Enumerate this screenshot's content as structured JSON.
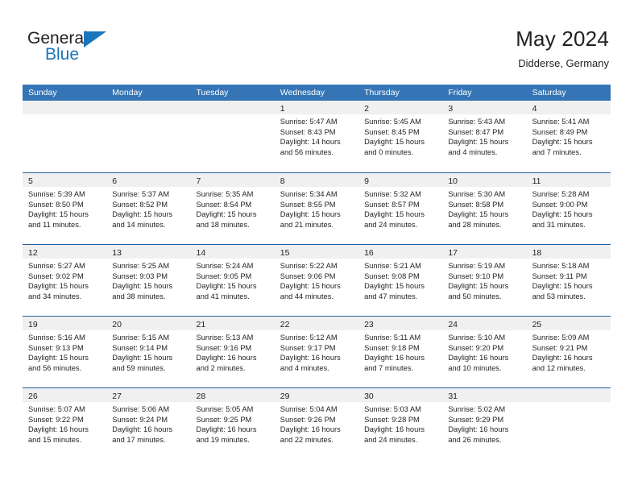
{
  "brand": {
    "name_part1": "General",
    "name_part2": "Blue"
  },
  "header": {
    "title": "May 2024",
    "subtitle": "Didderse, Germany"
  },
  "colors": {
    "header_blue": "#3575b5",
    "row_border_blue": "#1f5fa0",
    "day_band_gray": "#f0f0f0",
    "brand_blue": "#1b75bb",
    "text": "#231f20"
  },
  "weekdays": [
    "Sunday",
    "Monday",
    "Tuesday",
    "Wednesday",
    "Thursday",
    "Friday",
    "Saturday"
  ],
  "weeks": [
    [
      {
        "day": "",
        "lines": []
      },
      {
        "day": "",
        "lines": []
      },
      {
        "day": "",
        "lines": []
      },
      {
        "day": "1",
        "lines": [
          "Sunrise: 5:47 AM",
          "Sunset: 8:43 PM",
          "Daylight: 14 hours",
          "and 56 minutes."
        ]
      },
      {
        "day": "2",
        "lines": [
          "Sunrise: 5:45 AM",
          "Sunset: 8:45 PM",
          "Daylight: 15 hours",
          "and 0 minutes."
        ]
      },
      {
        "day": "3",
        "lines": [
          "Sunrise: 5:43 AM",
          "Sunset: 8:47 PM",
          "Daylight: 15 hours",
          "and 4 minutes."
        ]
      },
      {
        "day": "4",
        "lines": [
          "Sunrise: 5:41 AM",
          "Sunset: 8:49 PM",
          "Daylight: 15 hours",
          "and 7 minutes."
        ]
      }
    ],
    [
      {
        "day": "5",
        "lines": [
          "Sunrise: 5:39 AM",
          "Sunset: 8:50 PM",
          "Daylight: 15 hours",
          "and 11 minutes."
        ]
      },
      {
        "day": "6",
        "lines": [
          "Sunrise: 5:37 AM",
          "Sunset: 8:52 PM",
          "Daylight: 15 hours",
          "and 14 minutes."
        ]
      },
      {
        "day": "7",
        "lines": [
          "Sunrise: 5:35 AM",
          "Sunset: 8:54 PM",
          "Daylight: 15 hours",
          "and 18 minutes."
        ]
      },
      {
        "day": "8",
        "lines": [
          "Sunrise: 5:34 AM",
          "Sunset: 8:55 PM",
          "Daylight: 15 hours",
          "and 21 minutes."
        ]
      },
      {
        "day": "9",
        "lines": [
          "Sunrise: 5:32 AM",
          "Sunset: 8:57 PM",
          "Daylight: 15 hours",
          "and 24 minutes."
        ]
      },
      {
        "day": "10",
        "lines": [
          "Sunrise: 5:30 AM",
          "Sunset: 8:58 PM",
          "Daylight: 15 hours",
          "and 28 minutes."
        ]
      },
      {
        "day": "11",
        "lines": [
          "Sunrise: 5:28 AM",
          "Sunset: 9:00 PM",
          "Daylight: 15 hours",
          "and 31 minutes."
        ]
      }
    ],
    [
      {
        "day": "12",
        "lines": [
          "Sunrise: 5:27 AM",
          "Sunset: 9:02 PM",
          "Daylight: 15 hours",
          "and 34 minutes."
        ]
      },
      {
        "day": "13",
        "lines": [
          "Sunrise: 5:25 AM",
          "Sunset: 9:03 PM",
          "Daylight: 15 hours",
          "and 38 minutes."
        ]
      },
      {
        "day": "14",
        "lines": [
          "Sunrise: 5:24 AM",
          "Sunset: 9:05 PM",
          "Daylight: 15 hours",
          "and 41 minutes."
        ]
      },
      {
        "day": "15",
        "lines": [
          "Sunrise: 5:22 AM",
          "Sunset: 9:06 PM",
          "Daylight: 15 hours",
          "and 44 minutes."
        ]
      },
      {
        "day": "16",
        "lines": [
          "Sunrise: 5:21 AM",
          "Sunset: 9:08 PM",
          "Daylight: 15 hours",
          "and 47 minutes."
        ]
      },
      {
        "day": "17",
        "lines": [
          "Sunrise: 5:19 AM",
          "Sunset: 9:10 PM",
          "Daylight: 15 hours",
          "and 50 minutes."
        ]
      },
      {
        "day": "18",
        "lines": [
          "Sunrise: 5:18 AM",
          "Sunset: 9:11 PM",
          "Daylight: 15 hours",
          "and 53 minutes."
        ]
      }
    ],
    [
      {
        "day": "19",
        "lines": [
          "Sunrise: 5:16 AM",
          "Sunset: 9:13 PM",
          "Daylight: 15 hours",
          "and 56 minutes."
        ]
      },
      {
        "day": "20",
        "lines": [
          "Sunrise: 5:15 AM",
          "Sunset: 9:14 PM",
          "Daylight: 15 hours",
          "and 59 minutes."
        ]
      },
      {
        "day": "21",
        "lines": [
          "Sunrise: 5:13 AM",
          "Sunset: 9:16 PM",
          "Daylight: 16 hours",
          "and 2 minutes."
        ]
      },
      {
        "day": "22",
        "lines": [
          "Sunrise: 5:12 AM",
          "Sunset: 9:17 PM",
          "Daylight: 16 hours",
          "and 4 minutes."
        ]
      },
      {
        "day": "23",
        "lines": [
          "Sunrise: 5:11 AM",
          "Sunset: 9:18 PM",
          "Daylight: 16 hours",
          "and 7 minutes."
        ]
      },
      {
        "day": "24",
        "lines": [
          "Sunrise: 5:10 AM",
          "Sunset: 9:20 PM",
          "Daylight: 16 hours",
          "and 10 minutes."
        ]
      },
      {
        "day": "25",
        "lines": [
          "Sunrise: 5:09 AM",
          "Sunset: 9:21 PM",
          "Daylight: 16 hours",
          "and 12 minutes."
        ]
      }
    ],
    [
      {
        "day": "26",
        "lines": [
          "Sunrise: 5:07 AM",
          "Sunset: 9:22 PM",
          "Daylight: 16 hours",
          "and 15 minutes."
        ]
      },
      {
        "day": "27",
        "lines": [
          "Sunrise: 5:06 AM",
          "Sunset: 9:24 PM",
          "Daylight: 16 hours",
          "and 17 minutes."
        ]
      },
      {
        "day": "28",
        "lines": [
          "Sunrise: 5:05 AM",
          "Sunset: 9:25 PM",
          "Daylight: 16 hours",
          "and 19 minutes."
        ]
      },
      {
        "day": "29",
        "lines": [
          "Sunrise: 5:04 AM",
          "Sunset: 9:26 PM",
          "Daylight: 16 hours",
          "and 22 minutes."
        ]
      },
      {
        "day": "30",
        "lines": [
          "Sunrise: 5:03 AM",
          "Sunset: 9:28 PM",
          "Daylight: 16 hours",
          "and 24 minutes."
        ]
      },
      {
        "day": "31",
        "lines": [
          "Sunrise: 5:02 AM",
          "Sunset: 9:29 PM",
          "Daylight: 16 hours",
          "and 26 minutes."
        ]
      },
      {
        "day": "",
        "lines": []
      }
    ]
  ]
}
